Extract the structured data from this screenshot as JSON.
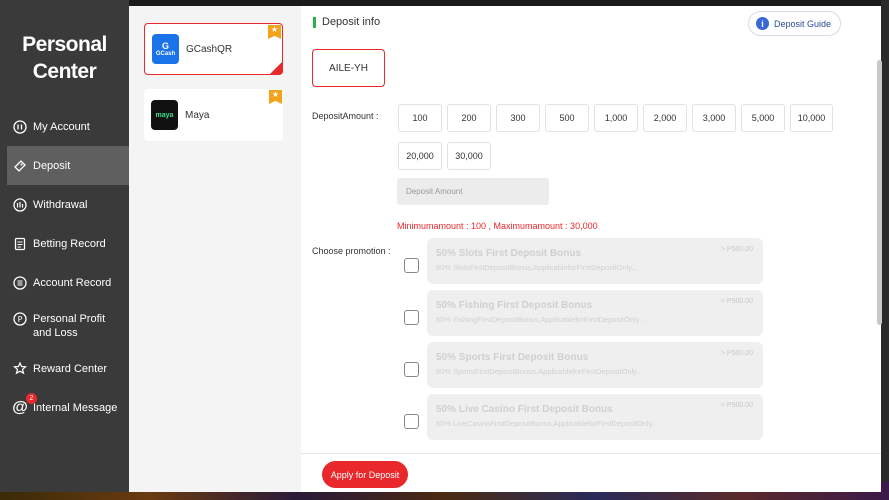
{
  "sidebar": {
    "title": "Personal Center",
    "items": [
      {
        "label": "My Account",
        "icon": "account-icon"
      },
      {
        "label": "Deposit",
        "icon": "deposit-icon",
        "active": true
      },
      {
        "label": "Withdrawal",
        "icon": "withdrawal-icon"
      },
      {
        "label": "Betting Record",
        "icon": "betting-record-icon"
      },
      {
        "label": "Account Record",
        "icon": "account-record-icon"
      },
      {
        "label": "Personal Profit and Loss",
        "icon": "profit-loss-icon"
      },
      {
        "label": "Reward Center",
        "icon": "reward-icon"
      },
      {
        "label": "Internal Message",
        "icon": "at-icon",
        "badge": "2"
      }
    ]
  },
  "methods": [
    {
      "name": "GCashQR",
      "logo_text": "GCash",
      "logo_color": "#1a73e8",
      "selected": true
    },
    {
      "name": "Maya",
      "logo_text": "maya",
      "logo_color": "#111111",
      "selected": false
    }
  ],
  "main": {
    "header": "Deposit info",
    "guide_label": "Deposit Guide",
    "channel": "AILE-YH",
    "amount_label": "DepositAmount :",
    "amounts_row1": [
      "100",
      "200",
      "300",
      "500",
      "1,000",
      "2,000",
      "3,000",
      "5,000",
      "10,000"
    ],
    "amounts_row2": [
      "20,000",
      "30,000"
    ],
    "amount_placeholder": "Deposit Amount",
    "limit_text": "Minimumamount : 100 , Maximumamount : 30,000",
    "promotion_label": "Choose promotion :",
    "promotions": [
      {
        "title": "50% Slots First Deposit Bonus",
        "desc": "50% SlotsFirstDepositBonus,ApplicableforFirstDepositOnly...",
        "amount": "> P500.00"
      },
      {
        "title": "50% Fishing First Deposit Bonus",
        "desc": "50% FishingFirstDepositBonus,ApplicableforFirstDepositOnly...",
        "amount": "> P500.00"
      },
      {
        "title": "50% Sports First Deposit Bonus",
        "desc": "50% SportsFirstDepositBonus,ApplicableforFirstDepositOnly...",
        "amount": "> P500.00"
      },
      {
        "title": "50% Live Casino First Deposit Bonus",
        "desc": "50% LiveCasinoFirstDepositBonus,ApplicableforFirstDepositOnly...",
        "amount": "> P500.00"
      }
    ],
    "apply_label": "Apply for Deposit"
  },
  "colors": {
    "accent": "#e8282b",
    "sidebar_bg": "#3a3a3a",
    "active_bg": "#5f5f5f",
    "green_marker": "#2bb24c"
  }
}
